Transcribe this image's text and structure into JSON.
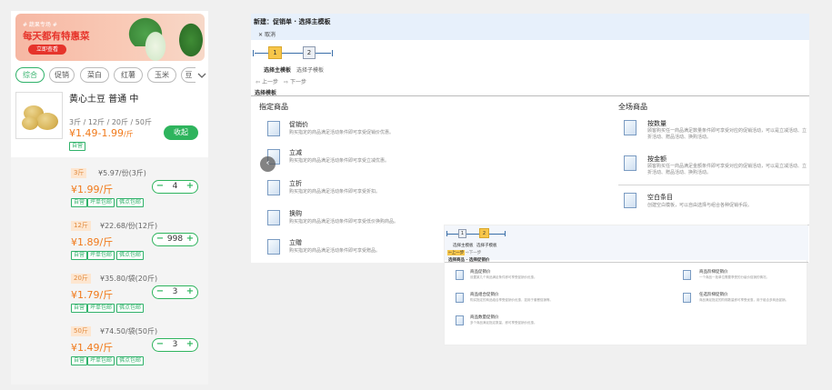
{
  "phone": {
    "banner": {
      "tag": "# 蔬果专场 #",
      "headline": "每天都有特惠菜",
      "button": "立即查看"
    },
    "categories": [
      "综合",
      "促销",
      "菜白",
      "红薯",
      "玉米",
      "豆"
    ],
    "product": {
      "title": "黄心土豆 普通 中",
      "units": "3斤 / 12斤 / 20斤 / 50斤",
      "price": "¥1.49-1.99",
      "price_unit": "/斤",
      "badge": "自营",
      "collapse_label": "收起"
    },
    "specs": [
      {
        "unit": "3斤",
        "per": "¥5.97/份(3斤)",
        "price": "¥1.99/斤",
        "qty": "4",
        "badges": [
          "自营",
          "坪单包邮",
          "佛点包邮"
        ]
      },
      {
        "unit": "12斤",
        "per": "¥22.68/份(12斤)",
        "price": "¥1.89/斤",
        "qty": "998",
        "badges": [
          "自营",
          "坪单包邮",
          "佛点包邮"
        ]
      },
      {
        "unit": "20斤",
        "per": "¥35.80/袋(20斤)",
        "price": "¥1.79/斤",
        "qty": "3",
        "badges": [
          "自营",
          "坪单包邮",
          "佛点包邮"
        ]
      },
      {
        "unit": "50斤",
        "per": "¥74.50/袋(50斤)",
        "price": "¥1.49/斤",
        "qty": "3",
        "badges": [
          "自营",
          "坪单包邮",
          "佛点包邮"
        ]
      }
    ],
    "stepper": {
      "minus": "−",
      "plus": "+"
    }
  },
  "editor": {
    "title": "新建：促销单 · 选择主模板",
    "cancel": "取消",
    "steps": [
      "1",
      "2"
    ],
    "tabs": [
      "选择主模板",
      "选择子模板"
    ],
    "prev": "上一步",
    "next": "下一步",
    "crumb": "选择模板",
    "left_section": "指定商品",
    "right_section": "全场商品",
    "left_items": [
      {
        "title": "促销价",
        "desc": "购买指定的商品满足活动条件即可享受促销价优惠。"
      },
      {
        "title": "立减",
        "desc": "购买指定的商品满足活动条件即可享受立减优惠。"
      },
      {
        "title": "立折",
        "desc": "购买指定的商品满足活动条件即可享受折扣。"
      },
      {
        "title": "换购",
        "desc": "购买指定的商品满足活动条件即可享受低价换购商品。"
      },
      {
        "title": "立赠",
        "desc": "购买指定的商品满足活动条件即可享受赠品。"
      }
    ],
    "right_items": [
      {
        "title": "按数量",
        "desc": "顾客购买任一商品满足数量条件即可享受对应的促销活动，可以是立减活动、立折活动、赠品活动、换购活动。"
      },
      {
        "title": "按金额",
        "desc": "顾客购买任一商品满足金额条件即可享受对应的促销活动，可以是立减活动、立折活动、赠品活动、换购活动。"
      },
      {
        "title": "空白条目",
        "desc": "创建空白模板，可以自由选择与组合各种促销手段。"
      }
    ]
  },
  "editor2": {
    "steps": [
      "1",
      "2"
    ],
    "tabs": [
      "选择主模板",
      "选择子模板"
    ],
    "prev": "上一步",
    "next": "下一步",
    "crumb": "选择商品 · 选择促销价",
    "left_items": [
      {
        "title": "商品促销价",
        "desc": "设置某几个商品满足条件即可享受促销价优惠。"
      },
      {
        "title": "商品组合促销价",
        "desc": "购买指定的商品组合享受促销价优惠，如用于套餐促销等。"
      },
      {
        "title": "商品数量促销价",
        "desc": "多个商品满足指定数量，即可享受促销价优惠。"
      }
    ],
    "right_items": [
      {
        "title": "商品阶梯促销价",
        "desc": "一个商品一批单位需要享受的分级价促销的情况。"
      },
      {
        "title": "任选阶梯促销价",
        "desc": "商品满足指定的阶梯数量即可享受优惠，用于组合多商品促销。"
      }
    ]
  }
}
